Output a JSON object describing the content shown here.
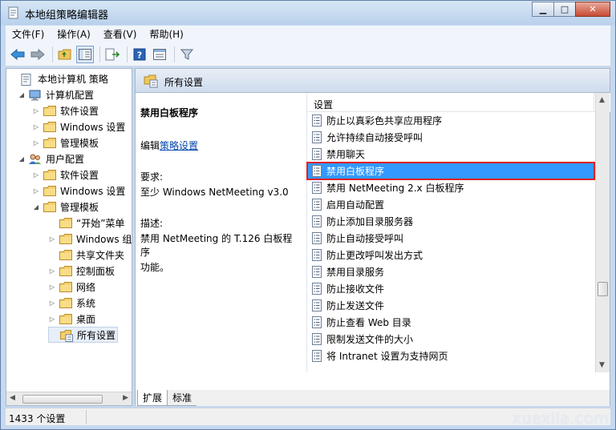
{
  "window": {
    "title": "本地组策略编辑器"
  },
  "menu": [
    "文件(F)",
    "操作(A)",
    "查看(V)",
    "帮助(H)"
  ],
  "tree": [
    {
      "label": "本地计算机 策略",
      "level": 0,
      "expander": "",
      "icon": "policy-icon"
    },
    {
      "label": "计算机配置",
      "level": 1,
      "expander": "◢",
      "icon": "computer-icon"
    },
    {
      "label": "软件设置",
      "level": 2,
      "expander": "▷",
      "icon": "folder-icon"
    },
    {
      "label": "Windows 设置",
      "level": 2,
      "expander": "▷",
      "icon": "folder-icon"
    },
    {
      "label": "管理模板",
      "level": 2,
      "expander": "▷",
      "icon": "folder-icon"
    },
    {
      "label": "用户配置",
      "level": 1,
      "expander": "◢",
      "icon": "users-icon"
    },
    {
      "label": "软件设置",
      "level": 2,
      "expander": "▷",
      "icon": "folder-icon"
    },
    {
      "label": "Windows 设置",
      "level": 2,
      "expander": "▷",
      "icon": "folder-icon"
    },
    {
      "label": "管理模板",
      "level": 2,
      "expander": "◢",
      "icon": "folder-icon"
    },
    {
      "label": "“开始”菜单",
      "level": 3,
      "expander": "",
      "icon": "folder-icon"
    },
    {
      "label": "Windows 组件",
      "level": 3,
      "expander": "▷",
      "icon": "folder-icon"
    },
    {
      "label": "共享文件夹",
      "level": 3,
      "expander": "",
      "icon": "folder-icon"
    },
    {
      "label": "控制面板",
      "level": 3,
      "expander": "▷",
      "icon": "folder-icon"
    },
    {
      "label": "网络",
      "level": 3,
      "expander": "▷",
      "icon": "folder-icon"
    },
    {
      "label": "系统",
      "level": 3,
      "expander": "▷",
      "icon": "folder-icon"
    },
    {
      "label": "桌面",
      "level": 3,
      "expander": "▷",
      "icon": "folder-icon"
    },
    {
      "label": "所有设置",
      "level": 3,
      "expander": "",
      "icon": "all-settings-icon"
    }
  ],
  "right": {
    "header": "所有设置",
    "description": {
      "title": "禁用白板程序",
      "edit_prefix": "编辑",
      "edit_link": "策略设置",
      "req_label": "要求:",
      "req_value": "至少 Windows NetMeeting v3.0",
      "desc_label": "描述:",
      "desc_line1": "禁用 NetMeeting 的 T.126 白板程序",
      "desc_line2": "功能。"
    },
    "list_header": "设置",
    "items": [
      "防止以真彩色共享应用程序",
      "允许持续自动接受呼叫",
      "禁用聊天",
      "禁用白板程序",
      "禁用 NetMeeting 2.x 白板程序",
      "启用自动配置",
      "防止添加目录服务器",
      "防止自动接受呼叫",
      "防止更改呼叫发出方式",
      "禁用目录服务",
      "防止接收文件",
      "防止发送文件",
      "防止查看 Web 目录",
      "限制发送文件的大小",
      "将 Intranet 设置为支持网页"
    ],
    "selected_index": 3,
    "tabs": [
      "扩展",
      "标准"
    ]
  },
  "status": "1433 个设置",
  "watermark": "xuexila.com"
}
